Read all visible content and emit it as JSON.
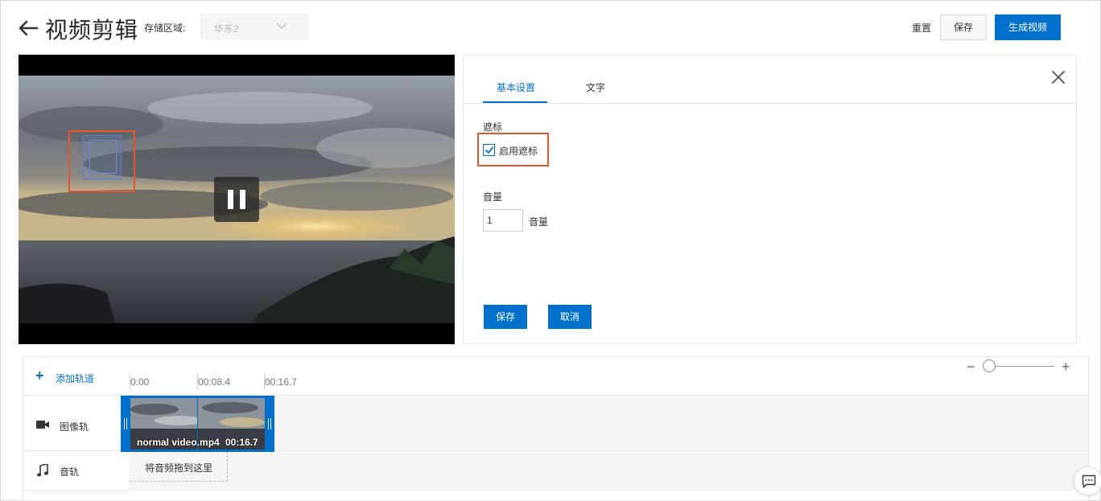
{
  "header": {
    "title": "视频剪辑",
    "region_label": "存储区域:",
    "region_value": "华东2",
    "reset_label": "重置",
    "save_label": "保存",
    "generate_label": "生成视频"
  },
  "panel": {
    "tabs": [
      {
        "label": "基本设置",
        "active": true
      },
      {
        "label": "文字",
        "active": false
      }
    ],
    "watermark": {
      "section_label": "遮标",
      "checkbox_label": "启用遮标",
      "checked": true
    },
    "volume": {
      "section_label": "音量",
      "value": "1",
      "unit_label": "音量"
    },
    "save_label": "保存",
    "cancel_label": "取消"
  },
  "timeline": {
    "add_track_label": "添加轨道",
    "ticks": [
      "0:00",
      "00:08.4",
      "00:16.7"
    ],
    "tracks": [
      {
        "label": "图像轨",
        "icon": "video-camera-icon"
      },
      {
        "label": "音轨",
        "icon": "music-note-icon"
      }
    ],
    "clip": {
      "name": "normal video.mp4",
      "duration": "00:16.7"
    },
    "audio_drop_hint": "将音频拖到这里"
  },
  "colors": {
    "primary": "#0070cc",
    "highlight": "#e8542c"
  }
}
